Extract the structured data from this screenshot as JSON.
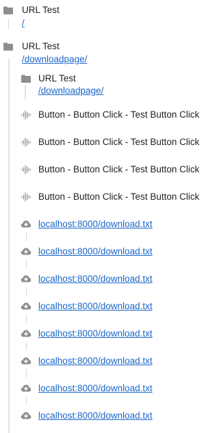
{
  "tree": {
    "root1": {
      "title": "URL Test",
      "link": "/"
    },
    "root2": {
      "title": "URL Test",
      "link": "/downloadpage/"
    },
    "child_url": {
      "title": "URL Test",
      "link": "/downloadpage/"
    },
    "button_events": [
      "Button - Button Click - Test Button Click",
      "Button - Button Click - Test Button Click",
      "Button - Button Click - Test Button Click",
      "Button - Button Click - Test Button Click"
    ],
    "downloads": [
      "localhost:8000/download.txt",
      "localhost:8000/download.txt",
      "localhost:8000/download.txt",
      "localhost:8000/download.txt",
      "localhost:8000/download.txt",
      "localhost:8000/download.txt",
      "localhost:8000/download.txt",
      "localhost:8000/download.txt"
    ]
  },
  "icons": {
    "folder": "folder-icon",
    "button_event": "waveform-icon",
    "download": "cloud-download-icon"
  },
  "colors": {
    "link": "#1a66c9",
    "icon": "#8e8e8e",
    "text": "#222222",
    "rail": "#e3e3e3"
  }
}
